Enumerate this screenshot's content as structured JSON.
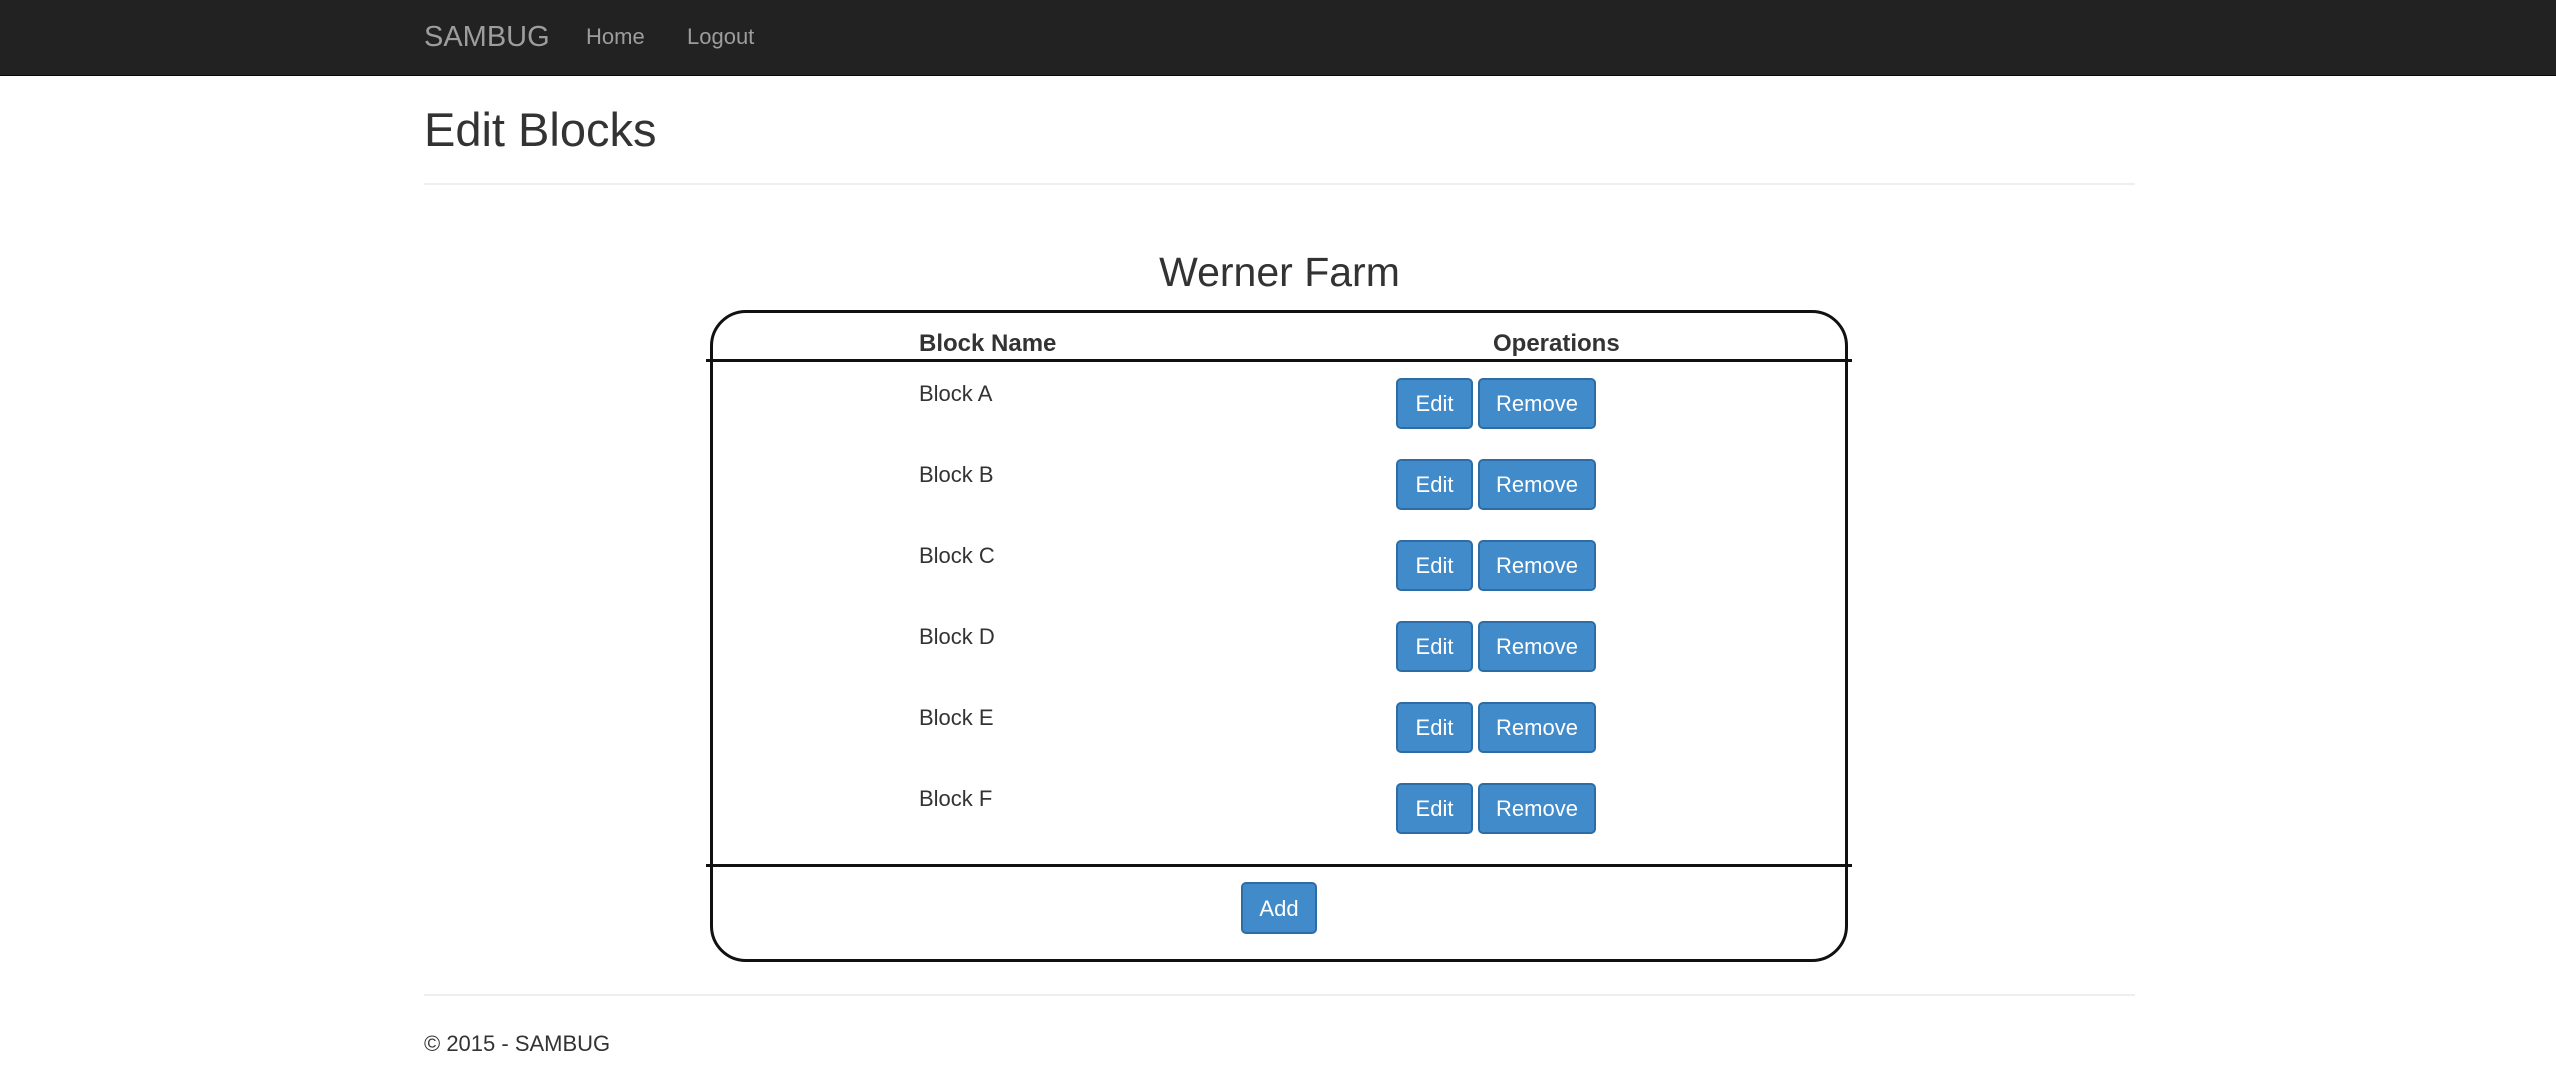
{
  "navbar": {
    "brand": "SAMBUG",
    "links": [
      {
        "label": "Home"
      },
      {
        "label": "Logout"
      }
    ]
  },
  "page": {
    "title": "Edit Blocks",
    "farm_name": "Werner Farm"
  },
  "table": {
    "headers": [
      "Block Name",
      "Operations"
    ],
    "rows": [
      {
        "name": "Block A",
        "edit_label": "Edit",
        "remove_label": "Remove"
      },
      {
        "name": "Block B",
        "edit_label": "Edit",
        "remove_label": "Remove"
      },
      {
        "name": "Block C",
        "edit_label": "Edit",
        "remove_label": "Remove"
      },
      {
        "name": "Block D",
        "edit_label": "Edit",
        "remove_label": "Remove"
      },
      {
        "name": "Block E",
        "edit_label": "Edit",
        "remove_label": "Remove"
      },
      {
        "name": "Block F",
        "edit_label": "Edit",
        "remove_label": "Remove"
      }
    ],
    "add_label": "Add"
  },
  "footer": {
    "text": "© 2015 - SAMBUG"
  },
  "colors": {
    "navbar_bg": "#222222",
    "nav_text": "#9d9d9d",
    "button_primary": "#428bca",
    "button_border": "#2e6da4",
    "text": "#333333"
  }
}
